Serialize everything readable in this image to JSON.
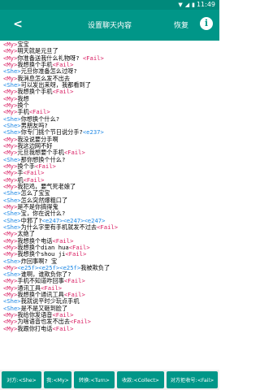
{
  "status": {
    "time": "11:49"
  },
  "appbar": {
    "title": "设置聊天内容",
    "restore": "恢复",
    "info": "i"
  },
  "lines": [
    [
      [
        "my",
        "<My>"
      ],
      [
        "t",
        "宝宝"
      ]
    ],
    [
      [
        "my",
        "<My>"
      ],
      [
        "t",
        "明天就是元旦了"
      ]
    ],
    [
      [
        "my",
        "<My>"
      ],
      [
        "t",
        "你准备送我什么礼物呀? "
      ],
      [
        "fail",
        "<Fail>"
      ]
    ],
    [
      [
        "my",
        "<My>"
      ],
      [
        "t",
        "我想换个手机"
      ],
      [
        "fail",
        "<Fail>"
      ]
    ],
    [
      [
        "she",
        "<She>"
      ],
      [
        "t",
        "元旦你准备怎么过呀?"
      ]
    ],
    [
      [
        "my",
        "<My>"
      ],
      [
        "t",
        "我消息怎么发不出去"
      ]
    ],
    [
      [
        "she",
        "<She>"
      ],
      [
        "t",
        "可以发出来呀，我都看到了"
      ]
    ],
    [
      [
        "my",
        "<My>"
      ],
      [
        "t",
        "我想换个手机"
      ],
      [
        "fail",
        "<Fail>"
      ]
    ],
    [
      [
        "my",
        "<My>"
      ],
      [
        "t",
        "我想"
      ]
    ],
    [
      [
        "my",
        "<My>"
      ],
      [
        "t",
        "换个"
      ]
    ],
    [
      [
        "my",
        "<My>"
      ],
      [
        "t",
        "手机"
      ],
      [
        "fail",
        "<Fail>"
      ]
    ],
    [
      [
        "she",
        "<She>"
      ],
      [
        "t",
        "你想换个什么?"
      ]
    ],
    [
      [
        "she",
        "<She>"
      ],
      [
        "t",
        "男朋友吗?"
      ]
    ],
    [
      [
        "she",
        "<She>"
      ],
      [
        "t",
        "你专门挑个节日说分手?"
      ],
      [
        "e",
        "<e237>"
      ]
    ],
    [
      [
        "my",
        "<My>"
      ],
      [
        "t",
        "我没说要分手啊"
      ]
    ],
    [
      [
        "my",
        "<My>"
      ],
      [
        "t",
        "我这边网不好"
      ]
    ],
    [
      [
        "my",
        "<My>"
      ],
      [
        "t",
        "元旦我想要个手机"
      ],
      [
        "fail",
        "<Fail>"
      ]
    ],
    [
      [
        "she",
        "<She>"
      ],
      [
        "t",
        "那你想换个什么?"
      ]
    ],
    [
      [
        "my",
        "<My>"
      ],
      [
        "t",
        "换个手"
      ],
      [
        "fail",
        "<Fail>"
      ]
    ],
    [
      [
        "my",
        "<My>"
      ],
      [
        "t",
        "手"
      ],
      [
        "fail",
        "<Fail>"
      ]
    ],
    [
      [
        "my",
        "<My>"
      ],
      [
        "t",
        "机"
      ],
      [
        "fail",
        "<Fail>"
      ]
    ],
    [
      [
        "my",
        "<My>"
      ],
      [
        "t",
        "我犯鸡，要气死老娘了"
      ]
    ],
    [
      [
        "she",
        "<She>"
      ],
      [
        "t",
        "怎么了宝宝"
      ]
    ],
    [
      [
        "she",
        "<She>"
      ],
      [
        "t",
        "怎么突然爆粗口了"
      ]
    ],
    [
      [
        "my",
        "<My>"
      ],
      [
        "t",
        "是不是你搞得鬼"
      ]
    ],
    [
      [
        "she",
        "<She>"
      ],
      [
        "t",
        "宝，你在说什么?"
      ]
    ],
    [
      [
        "she",
        "<She>"
      ],
      [
        "t",
        "中邪了?"
      ],
      [
        "e",
        "<e247><e247><e247>"
      ]
    ],
    [
      [
        "she",
        "<She>"
      ],
      [
        "t",
        "为什么字里有手机就发不过去"
      ],
      [
        "fail",
        "<Fail>"
      ]
    ],
    [
      [
        "my",
        "<My>"
      ],
      [
        "t",
        "太绝了"
      ]
    ],
    [
      [
        "my",
        "<My>"
      ],
      [
        "t",
        "我想换个电话"
      ],
      [
        "fail",
        "<Fail>"
      ]
    ],
    [
      [
        "my",
        "<My>"
      ],
      [
        "t",
        "我想换个dian hua"
      ],
      [
        "fail",
        "<Fail>"
      ]
    ],
    [
      [
        "my",
        "<My>"
      ],
      [
        "t",
        "我想换个shou ji"
      ],
      [
        "fail",
        "<Fail>"
      ]
    ],
    [
      [
        "she",
        "<She>"
      ],
      [
        "t",
        "炸回事啊? 宝"
      ]
    ],
    [
      [
        "my",
        "<My>"
      ],
      [
        "e",
        "<e25f><e25f><e25f>"
      ],
      [
        "t",
        "我被欺负了"
      ]
    ],
    [
      [
        "she",
        "<She>"
      ],
      [
        "t",
        "谁啊，谁欺负你了?"
      ]
    ],
    [
      [
        "my",
        "<My>"
      ],
      [
        "t",
        "手机不知道咋回事"
      ],
      [
        "fail",
        "<Fail>"
      ]
    ],
    [
      [
        "my",
        "<My>"
      ],
      [
        "t",
        "通讯工具"
      ],
      [
        "fail",
        "<Fail>"
      ]
    ],
    [
      [
        "my",
        "<My>"
      ],
      [
        "t",
        "我想换个通讯工具"
      ],
      [
        "fail",
        "<Fail>"
      ]
    ],
    [
      [
        "she",
        "<She>"
      ],
      [
        "t",
        "我就说平时少玩点手机"
      ]
    ],
    [
      [
        "she",
        "<She>"
      ],
      [
        "t",
        "是不是又砸到脸了"
      ]
    ],
    [
      [
        "my",
        "<My>"
      ],
      [
        "t",
        "我给你发语音"
      ],
      [
        "fail",
        "<Fail>"
      ]
    ],
    [
      [
        "my",
        "<My>"
      ],
      [
        "t",
        "为啥语音也发不出去"
      ],
      [
        "fail",
        "<Fail>"
      ]
    ],
    [
      [
        "my",
        "<My>"
      ],
      [
        "t",
        "我跟你打电话"
      ],
      [
        "fail",
        "<Fail>"
      ]
    ]
  ],
  "bottom": {
    "b1": "对方:<She>",
    "b2": "我:<My>",
    "b3": "转换:<Turn>",
    "b4": "收款:<Collect>",
    "b5": "对方拒收号:<Fail>"
  }
}
